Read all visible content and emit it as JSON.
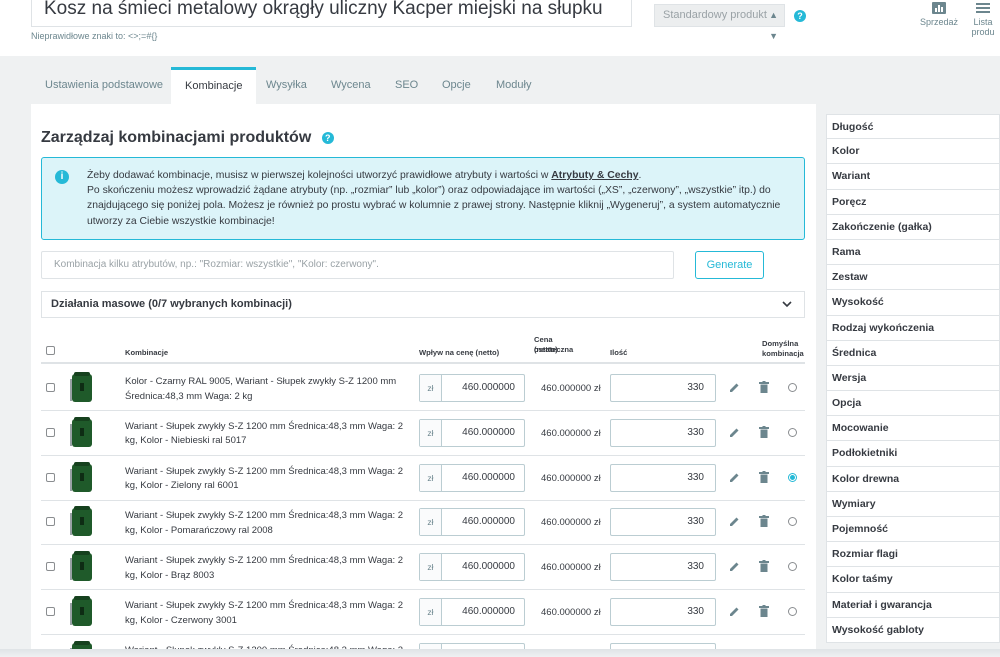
{
  "header": {
    "product_name": "Kosz na śmieci metalowy okrągły uliczny Kacper miejski na słupku",
    "invalid_chars_hint": "Nieprawidłowe znaki to: <>;=#{}",
    "product_type": "Standardowy produkt",
    "sales_label": "Sprzedaż",
    "product_list_label": "Lista produ"
  },
  "tabs": [
    {
      "label": "Ustawienia podstawowe"
    },
    {
      "label": "Kombinacje"
    },
    {
      "label": "Wysyłka"
    },
    {
      "label": "Wycena"
    },
    {
      "label": "SEO"
    },
    {
      "label": "Opcje"
    },
    {
      "label": "Moduły"
    }
  ],
  "combinations": {
    "title": "Zarządzaj kombinacjami produktów",
    "info": {
      "line1_pre": "Żeby dodawać kombinacje, musisz w pierwszej kolejności utworzyć prawidłowe atrybuty i wartości w ",
      "line1_link": "Atrybuty & Cechy",
      "line1_post": ".",
      "line2": "Po skończeniu możesz wprowadzić żądane atrybuty (np. „rozmiar” lub „kolor”) oraz odpowiadające im wartości („XS”, „czerwony”, „wszystkie” itp.) do",
      "line3": "znajdującego się poniżej pola. Możesz je również po prostu wybrać w kolumnie z prawej strony. Następnie kliknij „Wygeneruj”, a system automatycznie",
      "line4": "utworzy za Ciebie wszystkie kombinacje!"
    },
    "input_placeholder": "Kombinacja kilku atrybutów, np.: \"Rozmiar: wszystkie\", \"Kolor: czerwony\".",
    "generate_label": "Generate",
    "bulk_label": "Działania masowe (0/7 wybranych kombinacji)",
    "columns": {
      "combination": "Kombinacje",
      "impact": "Wpływ na cenę (netto)",
      "final_price_1": "Cena ostateczna",
      "final_price_2": "(netto)",
      "quantity": "Ilość",
      "default_1": "Domyślna",
      "default_2": "kombinacja"
    },
    "rows": [
      {
        "name": "Kolor - Czarny RAL 9005, Wariant - Słupek zwykły S-Z 1200 mm Średnica:48,3 mm Waga: 2 kg",
        "currency": "zł",
        "impact": "460.000000",
        "final": "460.000000 zł",
        "qty": "330",
        "default": false
      },
      {
        "name": "Wariant - Słupek zwykły S-Z 1200 mm Średnica:48,3 mm Waga: 2 kg, Kolor - Niebieski ral 5017",
        "currency": "zł",
        "impact": "460.000000",
        "final": "460.000000 zł",
        "qty": "330",
        "default": false
      },
      {
        "name": "Wariant - Słupek zwykły S-Z 1200 mm Średnica:48,3 mm Waga: 2 kg, Kolor - Zielony ral 6001",
        "currency": "zł",
        "impact": "460.000000",
        "final": "460.000000 zł",
        "qty": "330",
        "default": true
      },
      {
        "name": "Wariant - Słupek zwykły S-Z 1200 mm Średnica:48,3 mm Waga: 2 kg, Kolor - Pomarańczowy ral 2008",
        "currency": "zł",
        "impact": "460.000000",
        "final": "460.000000 zł",
        "qty": "330",
        "default": false
      },
      {
        "name": "Wariant - Słupek zwykły S-Z 1200 mm Średnica:48,3 mm Waga: 2 kg, Kolor - Brąz 8003",
        "currency": "zł",
        "impact": "460.000000",
        "final": "460.000000 zł",
        "qty": "330",
        "default": false
      },
      {
        "name": "Wariant - Słupek zwykły S-Z 1200 mm Średnica:48,3 mm Waga: 2 kg, Kolor - Czerwony 3001",
        "currency": "zł",
        "impact": "460.000000",
        "final": "460.000000 zł",
        "qty": "330",
        "default": false
      },
      {
        "name": "Wariant - Słupek zwykły S-Z 1200 mm Średnica:48,3 mm Waga: 2",
        "currency": "zł",
        "impact": "",
        "final": "",
        "qty": "",
        "default": false
      }
    ]
  },
  "attributes": [
    "Długość",
    "Kolor",
    "Wariant",
    "Poręcz",
    "Zakończenie (gałka)",
    "Rama",
    "Zestaw",
    "Wysokość",
    "Rodzaj wykończenia",
    "Średnica",
    "Wersja",
    "Opcja",
    "Mocowanie",
    "Podłokietniki",
    "Kolor drewna",
    "Wymiary",
    "Pojemność",
    "Rozmiar flagi",
    "Kolor taśmy",
    "Materiał i gwarancja",
    "Wysokość gabloty"
  ],
  "colors": {
    "accent": "#25b9d7",
    "info_bg": "#dcf4f9",
    "bin_green": "#1f5a2a"
  }
}
